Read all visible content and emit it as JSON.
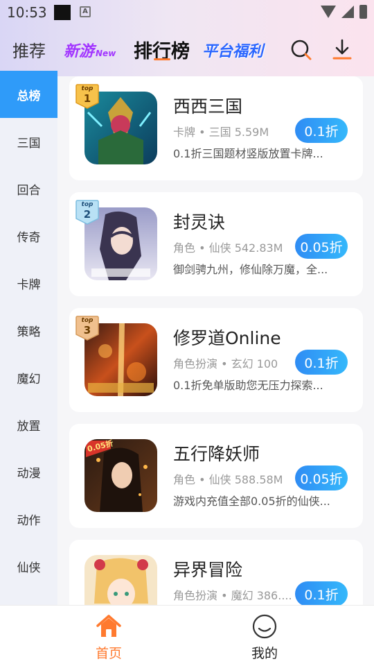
{
  "status_bar": {
    "time": "10:53"
  },
  "header": {
    "tabs": [
      {
        "label": "推荐"
      },
      {
        "label": "新游",
        "sup": "New"
      },
      {
        "label": "排行榜"
      },
      {
        "label": "平台福利"
      }
    ]
  },
  "sidebar": {
    "items": [
      "总榜",
      "三国",
      "回合",
      "传奇",
      "卡牌",
      "策略",
      "魔幻",
      "放置",
      "动漫",
      "动作",
      "仙侠"
    ]
  },
  "games": [
    {
      "rank": "1",
      "rank_top": "top",
      "name": "西西三国",
      "meta": "卡牌 • 三国    5.59M",
      "desc": "0.1折三国题材竖版放置卡牌...",
      "discount": "0.1折",
      "icon_label": ""
    },
    {
      "rank": "2",
      "rank_top": "top",
      "name": "封灵诀",
      "meta": "角色 • 仙侠 542.83M",
      "desc": "御剑骋九州，修仙除万魔，全...",
      "discount": "0.05折",
      "icon_label": ""
    },
    {
      "rank": "3",
      "rank_top": "top",
      "name": "修罗道Online",
      "meta": "角色扮演 • 玄幻    100",
      "desc": "0.1折免单版助您无压力探索...",
      "discount": "0.1折",
      "icon_label": ""
    },
    {
      "rank": "",
      "rank_top": "",
      "name": "五行降妖师",
      "meta": "角色 • 仙侠 588.58M",
      "desc": "游戏内充值全部0.05折的仙侠...",
      "discount": "0.05折",
      "icon_label": "0.05折"
    },
    {
      "rank": "",
      "rank_top": "",
      "name": "异界冒险",
      "meta": "角色扮演 • 魔幻 386....",
      "desc": "",
      "discount": "0.1折",
      "icon_label": ""
    }
  ],
  "bottom_nav": {
    "items": [
      {
        "label": "首页",
        "icon": "home-icon",
        "active": true
      },
      {
        "label": "我的",
        "icon": "smile-icon",
        "active": false
      }
    ]
  },
  "colors": {
    "accent": "#ff7a2f",
    "primary_blue": "#2f9bf9",
    "sidebar_bg": "#eff1f8"
  }
}
